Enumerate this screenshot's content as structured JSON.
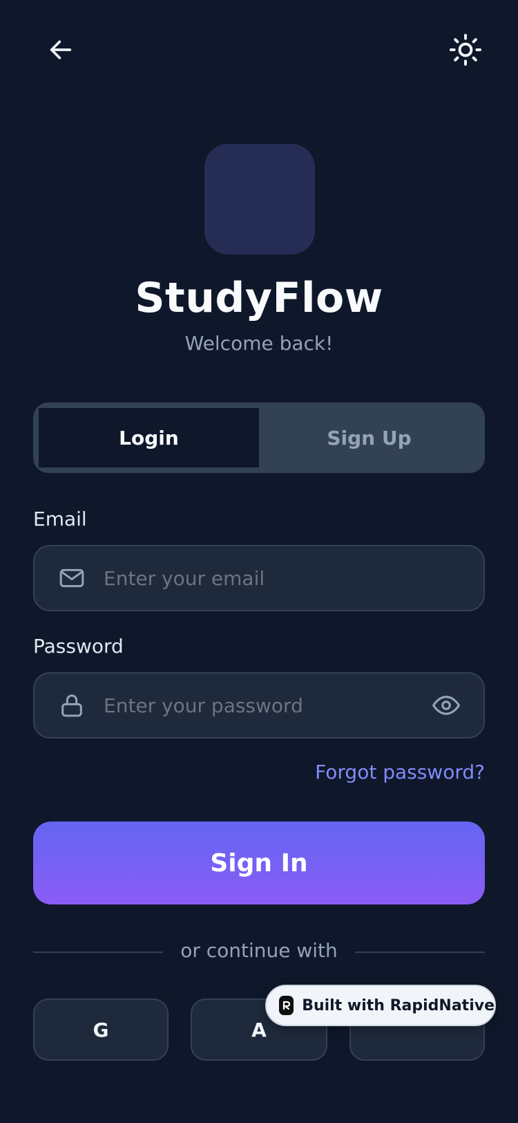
{
  "header": {
    "back_icon": "arrow-left-icon",
    "theme_icon": "sun-icon"
  },
  "brand": {
    "title": "StudyFlow",
    "subtitle": "Welcome back!",
    "logo_color": "#252d55"
  },
  "tabs": [
    {
      "label": "Login",
      "active": true
    },
    {
      "label": "Sign Up",
      "active": false
    }
  ],
  "form": {
    "email": {
      "label": "Email",
      "placeholder": "Enter your email",
      "value": "",
      "icon": "mail-icon"
    },
    "password": {
      "label": "Password",
      "placeholder": "Enter your password",
      "value": "",
      "icon": "lock-icon",
      "toggle_icon": "eye-icon"
    },
    "forgot_label": "Forgot password?",
    "submit_label": "Sign In"
  },
  "divider": {
    "label": "or continue with"
  },
  "social": [
    {
      "label": "G"
    },
    {
      "label": "A"
    },
    {
      "label": ""
    }
  ],
  "badge": {
    "label": "Built with RapidNative",
    "icon": "rapidnative-logo-icon"
  },
  "colors": {
    "background": "#0f172a",
    "surface": "#1e293b",
    "border": "#334155",
    "accent": "#818cf8",
    "button_gradient_start": "#6366f1",
    "button_gradient_end": "#8b5cf6"
  }
}
